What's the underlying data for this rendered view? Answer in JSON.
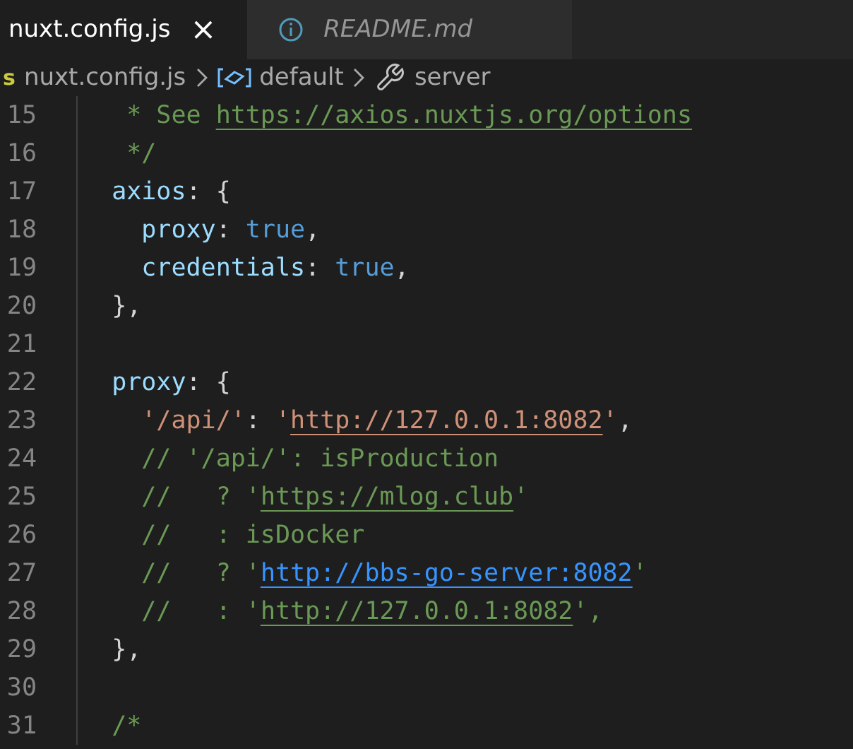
{
  "tabs": [
    {
      "label": "nuxt.config.js",
      "selected": true,
      "close": "×"
    },
    {
      "label": "README.md",
      "selected": false,
      "kind": "info"
    }
  ],
  "breadcrumb": [
    {
      "label": "nuxt.config.js",
      "kind": "file",
      "icon": "s"
    },
    {
      "label": "default",
      "kind": "variable"
    },
    {
      "label": "server",
      "kind": "property"
    }
  ],
  "lines": [
    {
      "number": "15",
      "tokens": [
        {
          "kind": "comment",
          "text": "   * See "
        },
        {
          "kind": "comment-link",
          "text": "https://axios.nuxtjs.org/options"
        }
      ]
    },
    {
      "number": "16",
      "tokens": [
        {
          "kind": "comment",
          "text": "   */"
        }
      ]
    },
    {
      "number": "17",
      "tokens": [
        {
          "kind": "key",
          "text": "  axios"
        },
        {
          "kind": "punct",
          "text": ": {"
        }
      ]
    },
    {
      "number": "18",
      "tokens": [
        {
          "kind": "key",
          "text": "    proxy"
        },
        {
          "kind": "punct",
          "text": ": "
        },
        {
          "kind": "bool",
          "text": "true"
        },
        {
          "kind": "punct",
          "text": ","
        }
      ]
    },
    {
      "number": "19",
      "tokens": [
        {
          "kind": "key",
          "text": "    credentials"
        },
        {
          "kind": "punct",
          "text": ": "
        },
        {
          "kind": "bool",
          "text": "true"
        },
        {
          "kind": "punct",
          "text": ","
        }
      ]
    },
    {
      "number": "20",
      "tokens": [
        {
          "kind": "punct",
          "text": "  },"
        }
      ]
    },
    {
      "number": "21"
    },
    {
      "number": "22",
      "tokens": [
        {
          "kind": "key",
          "text": "  proxy"
        },
        {
          "kind": "punct",
          "text": ": {"
        }
      ]
    },
    {
      "number": "23",
      "tokens": [
        {
          "kind": "string",
          "text": "    '/api/'"
        },
        {
          "kind": "punct",
          "text": ": "
        },
        {
          "kind": "string",
          "text": "'"
        },
        {
          "kind": "string-link",
          "text": "http://127.0.0.1:8082"
        },
        {
          "kind": "string",
          "text": "'"
        },
        {
          "kind": "punct",
          "text": ","
        }
      ]
    },
    {
      "number": "24",
      "tokens": [
        {
          "kind": "comment",
          "text": "    // '/api/': isProduction"
        }
      ]
    },
    {
      "number": "25",
      "tokens": [
        {
          "kind": "comment",
          "text": "    //   ? '"
        },
        {
          "kind": "comment-link",
          "text": "https://mlog.club"
        },
        {
          "kind": "comment",
          "text": "'"
        }
      ]
    },
    {
      "number": "26",
      "tokens": [
        {
          "kind": "comment",
          "text": "    //   : isDocker"
        }
      ]
    },
    {
      "number": "27",
      "tokens": [
        {
          "kind": "comment",
          "text": "    //   ? '"
        },
        {
          "kind": "focus-link",
          "text": "http://bbs-go-server:8082"
        },
        {
          "kind": "comment",
          "text": "'"
        }
      ]
    },
    {
      "number": "28",
      "tokens": [
        {
          "kind": "comment",
          "text": "    //   : '"
        },
        {
          "kind": "comment-link",
          "text": "http://127.0.0.1:8082"
        },
        {
          "kind": "comment",
          "text": "',"
        }
      ]
    },
    {
      "number": "29",
      "tokens": [
        {
          "kind": "punct",
          "text": "  },"
        }
      ]
    },
    {
      "number": "30"
    },
    {
      "number": "31",
      "tokens": [
        {
          "kind": "comment",
          "text": "  /*"
        }
      ]
    }
  ]
}
